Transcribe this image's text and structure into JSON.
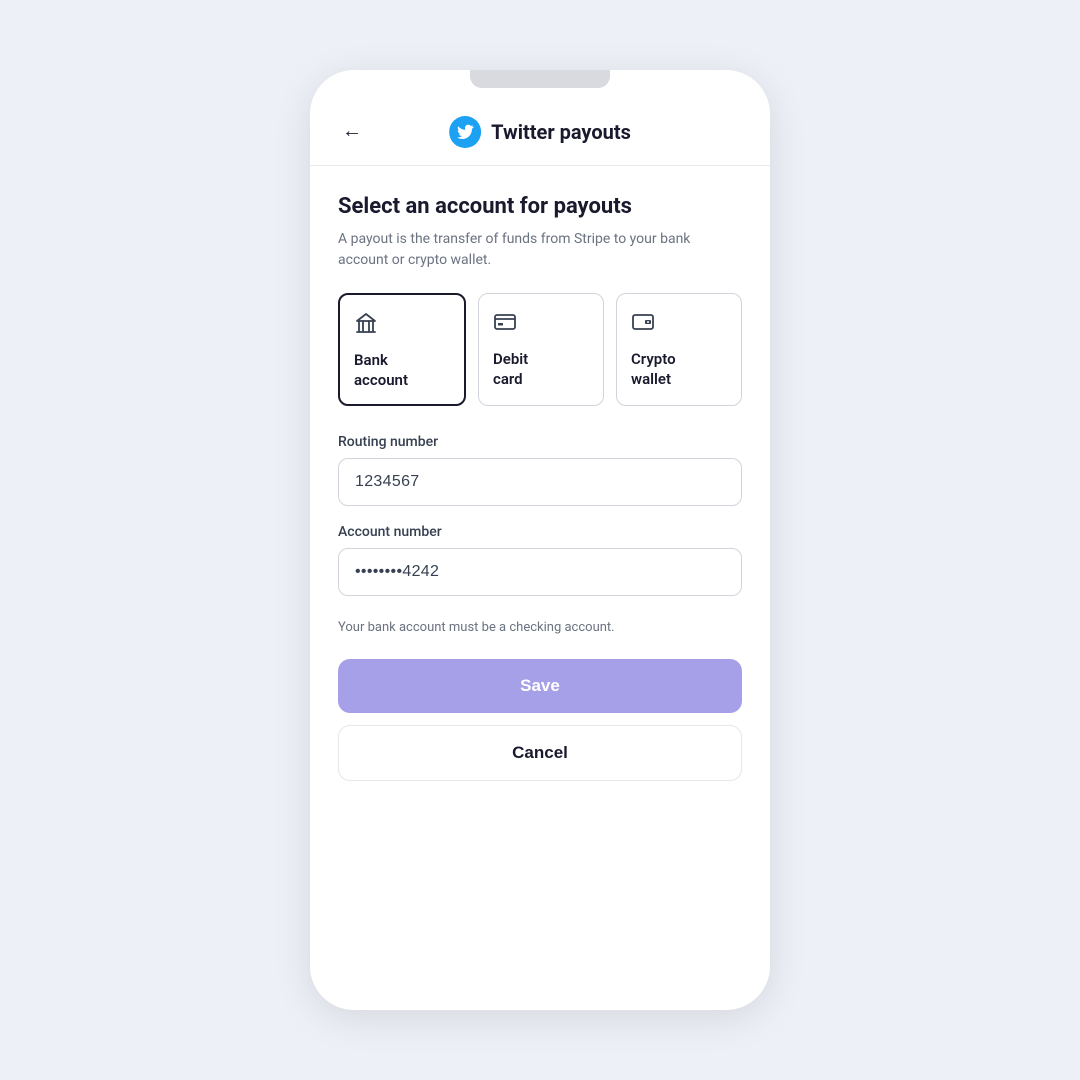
{
  "page": {
    "background": "#eef0f7"
  },
  "header": {
    "back_label": "←",
    "twitter_logo_alt": "Twitter logo",
    "title": "Twitter payouts"
  },
  "form": {
    "section_title": "Select an account for payouts",
    "section_desc": "A payout is the transfer of funds from Stripe to your bank account or crypto wallet.",
    "account_options": [
      {
        "id": "bank",
        "label": "Bank\naccount",
        "icon": "bank-icon",
        "selected": true
      },
      {
        "id": "debit",
        "label": "Debit\ncard",
        "icon": "debit-icon",
        "selected": false
      },
      {
        "id": "crypto",
        "label": "Crypto\nwallet",
        "icon": "crypto-icon",
        "selected": false
      }
    ],
    "routing_label": "Routing number",
    "routing_value": "1234567",
    "account_label": "Account number",
    "account_value": "••••••••4242",
    "hint": "Your bank account must be a checking account.",
    "save_label": "Save",
    "cancel_label": "Cancel"
  }
}
